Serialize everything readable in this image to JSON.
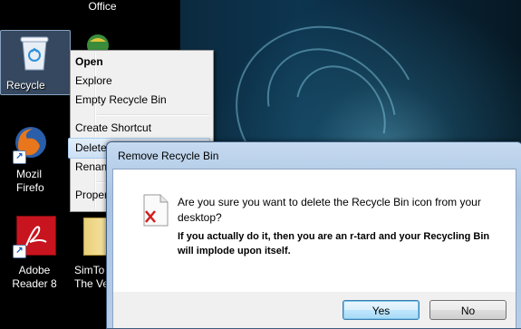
{
  "desktop": {
    "icons": [
      {
        "label": "Office"
      },
      {
        "label": "Recycle"
      },
      {
        "label_line1": "Mozil",
        "label_line2": "Firefo"
      },
      {
        "label_line1": "Adobe",
        "label_line2": "Reader 8"
      },
      {
        "label_line1": "SimTo",
        "label_line2": "The Ve"
      }
    ]
  },
  "context_menu": {
    "items": [
      {
        "label": "Open",
        "bold": true
      },
      {
        "label": "Explore"
      },
      {
        "label": "Empty Recycle Bin"
      },
      {
        "label": "Create Shortcut"
      },
      {
        "label": "Delete",
        "selected": true
      },
      {
        "label": "Renam"
      },
      {
        "label": "Proper"
      }
    ]
  },
  "dialog": {
    "title": "Remove Recycle Bin",
    "message_line1": "Are you sure you want to delete the Recycle Bin icon from your desktop?",
    "message_line2": "If you actually do it, then you are an r-tard and your Recycling Bin will implode upon itself.",
    "yes_label": "Yes",
    "no_label": "No"
  },
  "colors": {
    "selection": "#cde0f4",
    "dialog_frame": "#a9c4e3",
    "default_button": "#bee6fd"
  }
}
